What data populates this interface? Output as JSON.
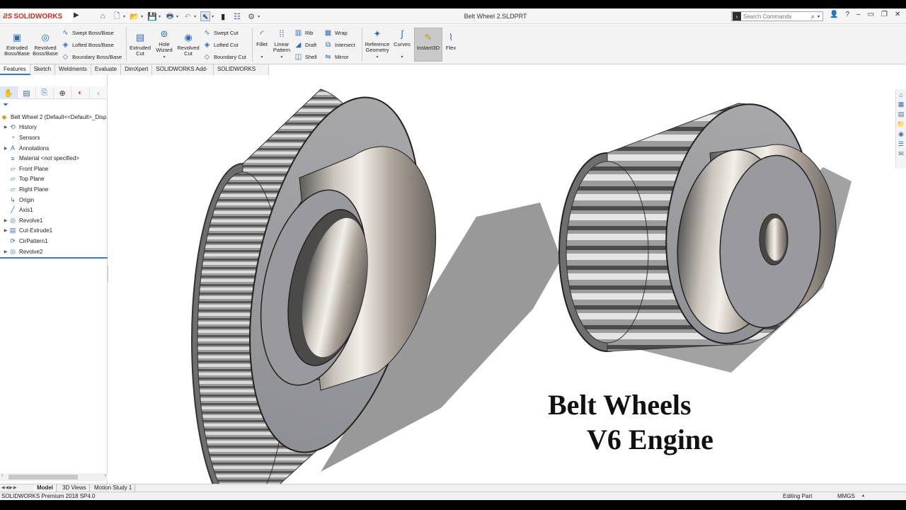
{
  "app": {
    "brand": "SOLIDWORKS",
    "doc_title": "Belt Wheel 2.SLDPRT",
    "search_placeholder": "Search Commands",
    "accent": "#d52b1e"
  },
  "commands": {
    "extruded_boss": "Extruded Boss/Base",
    "revolved_boss": "Revolved Boss/Base",
    "swept_boss": "Swept Boss/Base",
    "lofted_boss": "Lofted Boss/Base",
    "boundary_boss": "Boundary Boss/Base",
    "extruded_cut": "Extruded Cut",
    "hole_wizard": "Hole Wizard",
    "revolved_cut": "Revolved Cut",
    "swept_cut": "Swept Cut",
    "lofted_cut": "Lofted Cut",
    "boundary_cut": "Boundary Cut",
    "fillet": "Fillet",
    "linear_pattern": "Linear Pattern",
    "rib": "Rib",
    "draft": "Draft",
    "shell": "Shell",
    "wrap": "Wrap",
    "intersect": "Intersect",
    "mirror": "Mirror",
    "reference_geometry": "Reference Geometry",
    "curves": "Curves",
    "instant3d": "Instant3D",
    "flex": "Flex"
  },
  "tabs": [
    "Features",
    "Sketch",
    "Weldments",
    "Evaluate",
    "DimXpert",
    "SOLIDWORKS Add-Ins",
    "SOLIDWORKS MBD"
  ],
  "tree": {
    "root": "Belt Wheel 2  (Default<<Default>_Disp",
    "items": [
      {
        "label": "History",
        "icon": "history-icon",
        "expandable": true
      },
      {
        "label": "Sensors",
        "icon": "sensors-icon",
        "expandable": false
      },
      {
        "label": "Annotations",
        "icon": "annotations-icon",
        "expandable": true
      },
      {
        "label": "Material <not specified>",
        "icon": "material-icon",
        "expandable": false
      },
      {
        "label": "Front Plane",
        "icon": "plane-icon",
        "expandable": false
      },
      {
        "label": "Top Plane",
        "icon": "plane-icon",
        "expandable": false
      },
      {
        "label": "Right Plane",
        "icon": "plane-icon",
        "expandable": false
      },
      {
        "label": "Origin",
        "icon": "origin-icon",
        "expandable": false
      },
      {
        "label": "Axis1",
        "icon": "axis-icon",
        "expandable": false
      },
      {
        "label": "Revolve1",
        "icon": "revolve-icon",
        "expandable": true
      },
      {
        "label": "Cut-Extrude1",
        "icon": "cut-extrude-icon",
        "expandable": true
      },
      {
        "label": "CirPattern1",
        "icon": "circular-pattern-icon",
        "expandable": false
      },
      {
        "label": "Revolve2",
        "icon": "revolve-icon",
        "expandable": true
      }
    ]
  },
  "graphics": {
    "caption_line1": "Belt Wheels",
    "caption_line2": "V6 Engine"
  },
  "bottom_tabs": [
    "Model",
    "3D Views",
    "Motion Study 1"
  ],
  "status": {
    "product": "SOLIDWORKS Premium 2018 SP4.0",
    "mode": "Editing Part",
    "units": "MMGS"
  }
}
